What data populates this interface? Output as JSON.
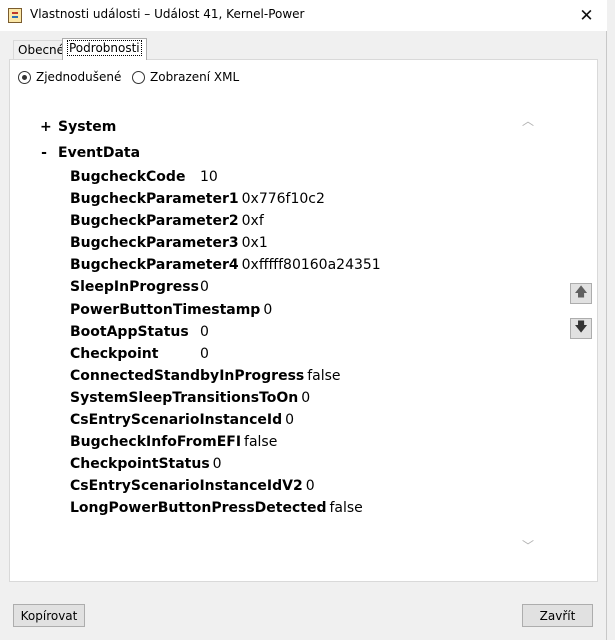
{
  "window": {
    "title": "Vlastnosti události – Událost 41, Kernel-Power",
    "close_glyph": "✕"
  },
  "tabs": [
    {
      "label": "Obecné",
      "active": false
    },
    {
      "label": "Podrobnosti",
      "active": true
    }
  ],
  "view_options": [
    {
      "label": "Zjednodušené",
      "checked": true
    },
    {
      "label": "Zobrazení XML",
      "checked": false
    }
  ],
  "tree": {
    "system": {
      "toggle": "+",
      "label": "System"
    },
    "eventdata": {
      "toggle": "-",
      "label": "EventData"
    }
  },
  "event_data": [
    {
      "name": "BugcheckCode",
      "value": "10"
    },
    {
      "name": "BugcheckParameter1",
      "value": "0x776f10c2"
    },
    {
      "name": "BugcheckParameter2",
      "value": "0xf"
    },
    {
      "name": "BugcheckParameter3",
      "value": "0x1"
    },
    {
      "name": "BugcheckParameter4",
      "value": "0xfffff80160a24351"
    },
    {
      "name": "SleepInProgress",
      "value": "0"
    },
    {
      "name": "PowerButtonTimestamp",
      "value": "0"
    },
    {
      "name": "BootAppStatus",
      "value": "0"
    },
    {
      "name": "Checkpoint",
      "value": "0"
    },
    {
      "name": "ConnectedStandbyInProgress",
      "value": "false"
    },
    {
      "name": "SystemSleepTransitionsToOn",
      "value": "0"
    },
    {
      "name": "CsEntryScenarioInstanceId",
      "value": "0"
    },
    {
      "name": "BugcheckInfoFromEFI",
      "value": "false"
    },
    {
      "name": "CheckpointStatus",
      "value": "0"
    },
    {
      "name": "CsEntryScenarioInstanceIdV2",
      "value": "0"
    },
    {
      "name": "LongPowerButtonPressDetected",
      "value": "false"
    }
  ],
  "side_buttons": {
    "up": "🡅",
    "down": "🡇"
  },
  "buttons": {
    "copy": "Kopírovat",
    "close": "Zavřít"
  },
  "icons": {
    "app": "event-viewer-icon",
    "close": "close-icon",
    "scroll_up": "chevron-up-icon",
    "scroll_down": "chevron-down-icon"
  }
}
